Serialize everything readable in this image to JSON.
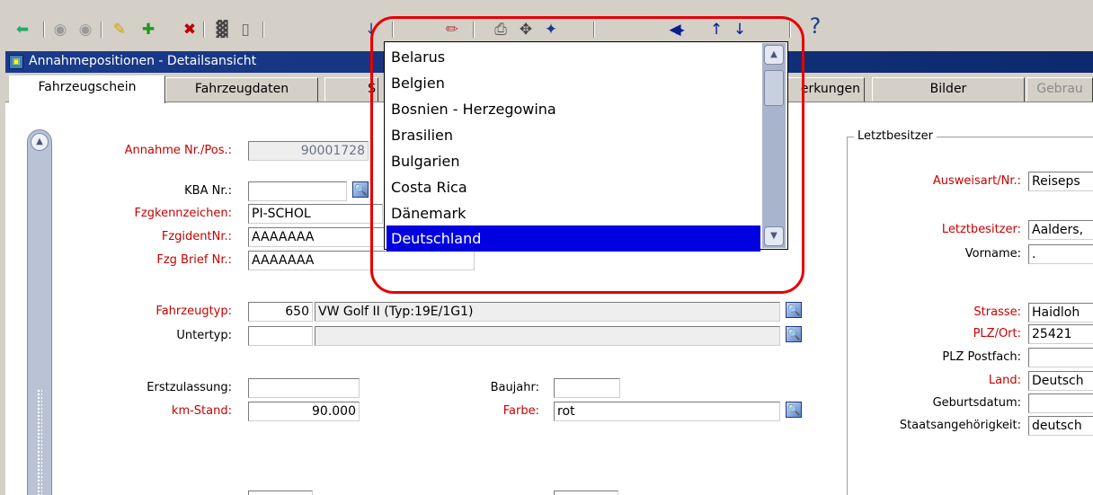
{
  "toolbar": {
    "icons": [
      "exit-icon",
      "back-icon",
      "forward-icon",
      "edit-icon",
      "add-icon",
      "delete-icon",
      "calculator-icon",
      "page-icon",
      "down-arrow-icon",
      "eraser-icon",
      "printer-icon",
      "select-icon",
      "tool-icon",
      "prev-icon",
      "next-icon",
      "up-icon",
      "down-icon",
      "help-icon"
    ],
    "help_glyph": "?"
  },
  "window": {
    "title": "Annahmepositionen - Detailsansicht"
  },
  "tabs": [
    {
      "label": "Fahrzeugschein",
      "active": true
    },
    {
      "label": "Fahrzeugdaten"
    },
    {
      "label": "S"
    },
    {
      "label": "erkungen"
    },
    {
      "label": "Bilder"
    },
    {
      "label": "Gebrau",
      "dim": true
    }
  ],
  "form": {
    "annahme_label": "Annahme Nr./Pos.:",
    "annahme_value": "90001728",
    "kba_label": "KBA Nr.:",
    "kba_value": "",
    "kennzeichen_label": "Fzgkennzeichen:",
    "kennzeichen_value": "PI-SCHOL",
    "ident_label": "FzgidentNr.:",
    "ident_value": "AAAAAAA",
    "brief_label": "Fzg Brief Nr.:",
    "brief_value": "AAAAAAA",
    "typ_label": "Fahrzeugtyp:",
    "typ_code": "650",
    "typ_name": "VW Golf II (Typ:19E/1G1)",
    "untertyp_label": "Untertyp:",
    "erstzulassung_label": "Erstzulassung:",
    "baujahr_label": "Baujahr:",
    "km_label": "km-Stand:",
    "km_value": "90.000",
    "farbe_label": "Farbe:",
    "farbe_value": "rot"
  },
  "letztbesitzer": {
    "group_title": "Letztbesitzer",
    "ausweis_label": "Ausweisart/Nr.:",
    "ausweis_value": "Reiseps",
    "name_label": "Letztbesitzer:",
    "name_value": "Aalders,",
    "vorname_label": "Vorname:",
    "vorname_value": ".",
    "strasse_label": "Strasse:",
    "strasse_value": "Haidloh",
    "plz_label": "PLZ/Ort:",
    "plz_value": "25421",
    "postfach_label": "PLZ Postfach:",
    "land_label": "Land:",
    "land_value": "Deutsch",
    "geburt_label": "Geburtsdatum:",
    "staat_label": "Staatsangehörigkeit:",
    "staat_value": "deutsch"
  },
  "dropdown": {
    "options": [
      "Belarus",
      "Belgien",
      "Bosnien - Herzegowina",
      "Brasilien",
      "Bulgarien",
      "Costa Rica",
      "Dänemark",
      "Deutschland"
    ],
    "selected_index": 7
  },
  "colors": {
    "title_bar": "#1a3b8c",
    "required_label": "#c80000",
    "selection": "#0000e0",
    "highlight": "#e60000"
  }
}
